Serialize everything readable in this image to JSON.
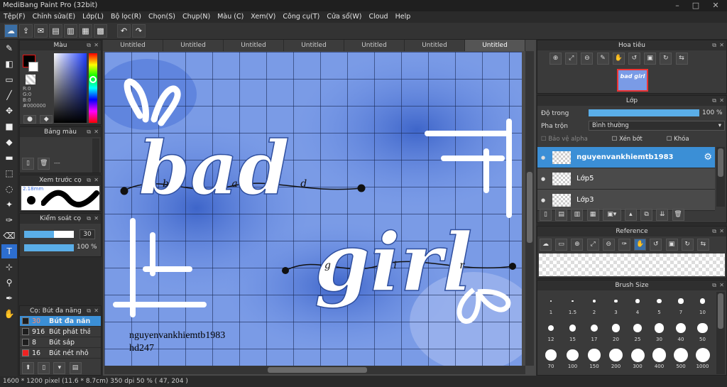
{
  "window": {
    "title": "MediBang Paint Pro (32bit)"
  },
  "menu": [
    "Tệp(F)",
    "Chỉnh sửa(E)",
    "Lớp(L)",
    "Bộ lọc(R)",
    "Chọn(S)",
    "Chụp(N)",
    "Màu (C)",
    "Xem(V)",
    "Công cụ(T)",
    "Cửa sổ(W)",
    "Cloud",
    "Help"
  ],
  "color_panel": {
    "title": "Màu",
    "r": "R:0",
    "g": "G:0",
    "b": "B:0",
    "hex": "#000000"
  },
  "palette_panel": {
    "title": "Bảng màu",
    "value": "---"
  },
  "preview_panel": {
    "title": "Xem trước cọ",
    "size": "2.18mm"
  },
  "brush_control": {
    "title": "Kiểm soát cọ",
    "size_value": "30",
    "opacity_value": "100 %",
    "size_fill": 0.6,
    "opacity_fill": 1.0
  },
  "brush_list": {
    "title": "Cọ: Bút đa năng",
    "items": [
      {
        "size": "30",
        "name": "Bút đa năng",
        "color": "#1e1e1e",
        "active": true
      },
      {
        "size": "916",
        "name": "Bút phát thảo",
        "color": "#1e1e1e",
        "active": false
      },
      {
        "size": "8",
        "name": "Bút sáp",
        "color": "#1e1e1e",
        "active": false
      },
      {
        "size": "16",
        "name": "Bút nét nhỏ",
        "color": "#ee2222",
        "active": false
      }
    ]
  },
  "tabs": [
    "Untitled",
    "Untitled",
    "Untitled",
    "Untitled",
    "Untitled",
    "Untitled",
    "Untitled"
  ],
  "artwork": {
    "line1": "bad",
    "line2": "girl",
    "small1": "b a d",
    "small2": "g i r l",
    "credit1": "nguyenvankhiemtb1983",
    "credit2": "hd247"
  },
  "navigator": {
    "title": "Hoa tiêu",
    "thumb_text": "bad girl"
  },
  "layer_panel": {
    "title": "Lớp",
    "opacity_label": "Độ trong",
    "opacity_value": "100 %",
    "opacity_fill": 1.0,
    "blend_label": "Pha trộn",
    "blend_value": "Bình thường",
    "protect_alpha": "Bảo vệ alpha",
    "clipping": "Xén bớt",
    "lock": "Khóa",
    "layers": [
      {
        "name": "nguyenvankhiemtb1983",
        "active": true
      },
      {
        "name": "Lớp5",
        "active": false
      },
      {
        "name": "Lớp3",
        "active": false
      }
    ]
  },
  "reference_panel": {
    "title": "Reference"
  },
  "brush_size_panel": {
    "title": "Brush Size",
    "sizes": [
      "1",
      "1.5",
      "2",
      "3",
      "4",
      "5",
      "7",
      "10",
      "12",
      "15",
      "17",
      "20",
      "25",
      "30",
      "40",
      "50",
      "70",
      "100",
      "150",
      "200",
      "300",
      "400",
      "500",
      "1000"
    ]
  },
  "status": {
    "text": "1600 * 1200 pixel   (11.6 * 8.7cm)  350 dpi   50 %   ( 47, 204 )"
  },
  "colors": {
    "accent": "#2f7bd6",
    "art_blue": "#5f86e0",
    "layer_active": "#3b8fd6"
  }
}
